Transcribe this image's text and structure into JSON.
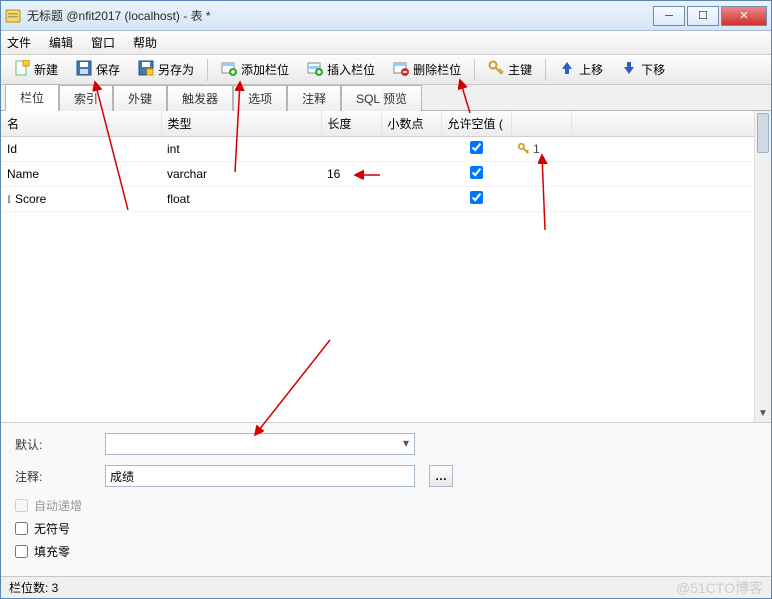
{
  "window": {
    "title": "无标题 @nfit2017 (localhost) - 表 *"
  },
  "menu": {
    "file": "文件",
    "edit": "编辑",
    "window": "窗口",
    "help": "帮助"
  },
  "toolbar": {
    "new": "新建",
    "save": "保存",
    "saveas": "另存为",
    "addfield": "添加栏位",
    "insertfield": "插入栏位",
    "deletefield": "删除栏位",
    "primarykey": "主键",
    "moveup": "上移",
    "movedown": "下移"
  },
  "tabs": {
    "fields": "栏位",
    "indexes": "索引",
    "foreignkeys": "外键",
    "triggers": "触发器",
    "options": "选项",
    "comment": "注释",
    "sqlpreview": "SQL 预览"
  },
  "grid": {
    "headers": {
      "name": "名",
      "type": "类型",
      "length": "长度",
      "decimals": "小数点",
      "allownull": "允许空值 (",
      "key": ""
    },
    "rows": [
      {
        "name": "Id",
        "type": "int",
        "length": "",
        "decimals": "",
        "allownull": true,
        "pk": "1"
      },
      {
        "name": "Name",
        "type": "varchar",
        "length": "16",
        "decimals": "",
        "allownull": true,
        "pk": ""
      },
      {
        "name": "Score",
        "type": "float",
        "length": "",
        "decimals": "",
        "allownull": true,
        "pk": ""
      }
    ]
  },
  "props": {
    "default_label": "默认:",
    "default_value": "",
    "comment_label": "注释:",
    "comment_value": "成绩",
    "autoinc": "自动递增",
    "unsigned": "无符号",
    "zerofill": "填充零"
  },
  "status": {
    "fieldcount": "栏位数: 3",
    "watermark": "@51CTO博客"
  }
}
